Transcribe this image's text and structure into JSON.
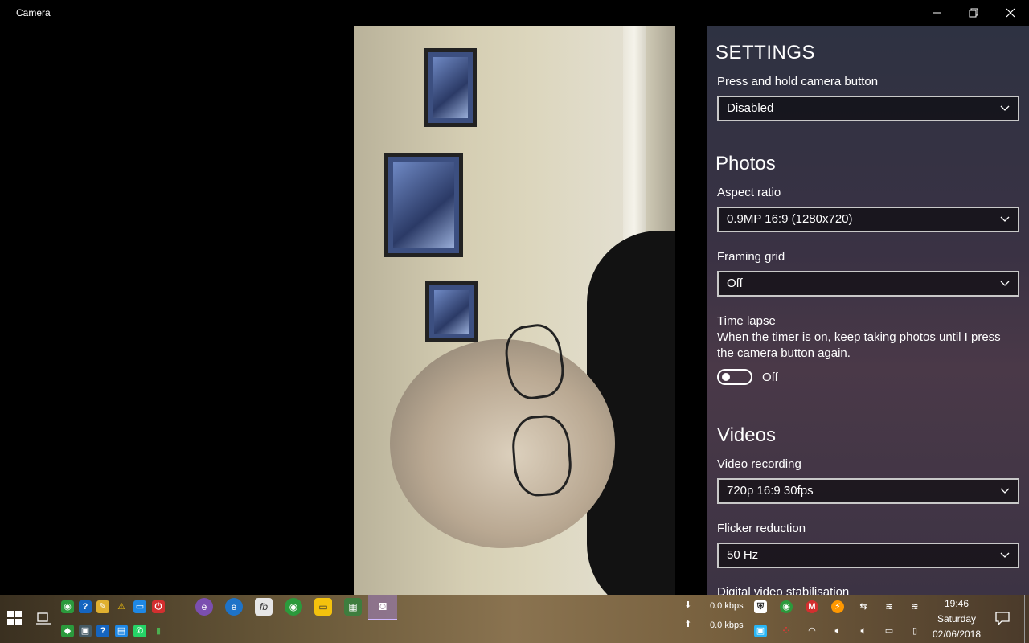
{
  "window": {
    "title": "Camera",
    "minimize_icon": "minimize-icon",
    "maximize_icon": "restore-icon",
    "close_icon": "close-icon"
  },
  "settings": {
    "heading": "SETTINGS",
    "camera_button": {
      "label": "Press and hold camera button",
      "value": "Disabled"
    },
    "photos": {
      "heading": "Photos",
      "aspect_ratio": {
        "label": "Aspect ratio",
        "value": "0.9MP 16:9 (1280x720)"
      },
      "framing_grid": {
        "label": "Framing grid",
        "value": "Off"
      },
      "time_lapse": {
        "label": "Time lapse",
        "description": "When the timer is on, keep taking photos until I press the camera button again.",
        "state": "Off"
      }
    },
    "videos": {
      "heading": "Videos",
      "video_recording": {
        "label": "Video recording",
        "value": "720p 16:9 30fps"
      },
      "flicker_reduction": {
        "label": "Flicker reduction",
        "value": "50 Hz"
      },
      "next_label": "Digital video stabilisation"
    }
  },
  "taskbar": {
    "download_speed": "0.0 kbps",
    "upload_speed": "0.0 kbps",
    "time": "19:46",
    "day": "Saturday",
    "date": "02/06/2018"
  },
  "colors": {
    "accent": "#1a73e8",
    "panel_bg": "#33313f",
    "dropdown_border": "#c9c9c9"
  }
}
